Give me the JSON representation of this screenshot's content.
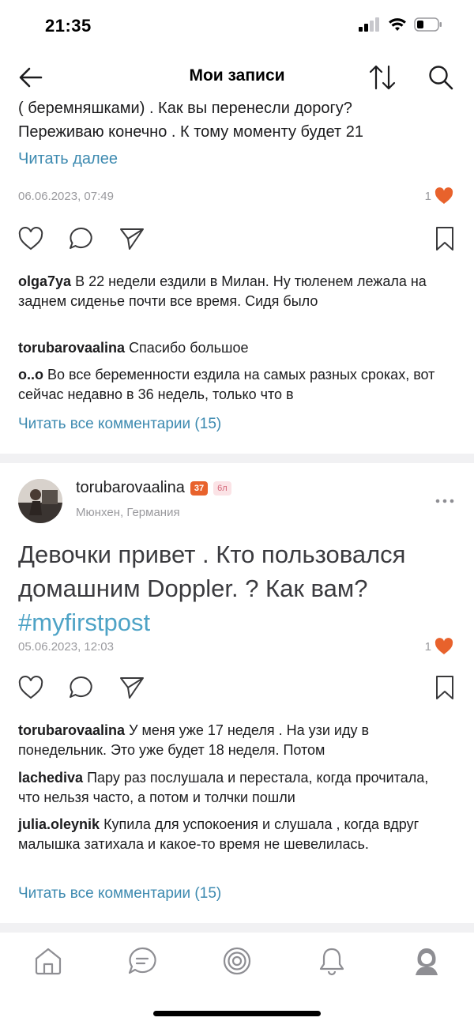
{
  "status_bar": {
    "time": "21:35"
  },
  "nav": {
    "title": "Мои записи"
  },
  "post1": {
    "text_lines": [
      "( беремняшками) . Как вы перенесли дорогу?",
      "Переживаю конечно . К тому моменту будет 21"
    ],
    "read_more": "Читать далее",
    "date": "06.06.2023, 07:49",
    "likes": "1",
    "comments": [
      {
        "author": "olga7ya",
        "text": "В 22 недели ездили в Милан. Ну тюленем лежала на заднем сиденье почти все время. Сидя было"
      },
      {
        "author": "torubarovaalina",
        "text": "Спасибо большое"
      },
      {
        "author": "o..o",
        "text": "Во все беременности ездила на самых разных сроках, вот сейчас недавно в 36 недель, только что в"
      }
    ],
    "all_comments": "Читать все комментарии (15)"
  },
  "post2": {
    "username": "torubarovaalina",
    "level_badge": "37",
    "kid_badge": "6л",
    "location": "Мюнхен, Германия",
    "text": "Девочки привет . Кто пользовался домашним Doppler. ? Как вам?",
    "hashtag": "#myfirstpost",
    "date": "05.06.2023, 12:03",
    "likes": "1",
    "comments": [
      {
        "author": "torubarovaalina",
        "text": "У меня уже 17 неделя . На узи иду в понедельник. Это уже будет 18 неделя. Потом"
      },
      {
        "author": "lachediva",
        "text": "Пару раз послушала и перестала, когда прочитала, что нельзя часто, а потом и толчки пошли"
      },
      {
        "author": "julia.oleynik",
        "text": "Купила для успокоения и слушала , когда вдруг малышка затихала и какое-то время не шевелилась."
      }
    ],
    "all_comments": "Читать все комментарии (15)"
  },
  "tab_bar": {
    "items": [
      "home-icon",
      "chat-icon",
      "target-icon",
      "bell-icon",
      "profile-icon"
    ]
  },
  "colors": {
    "link": "#3d8ab0",
    "hashtag": "#4ea3c6",
    "like": "#e8622c",
    "badge": "#e8622c"
  }
}
